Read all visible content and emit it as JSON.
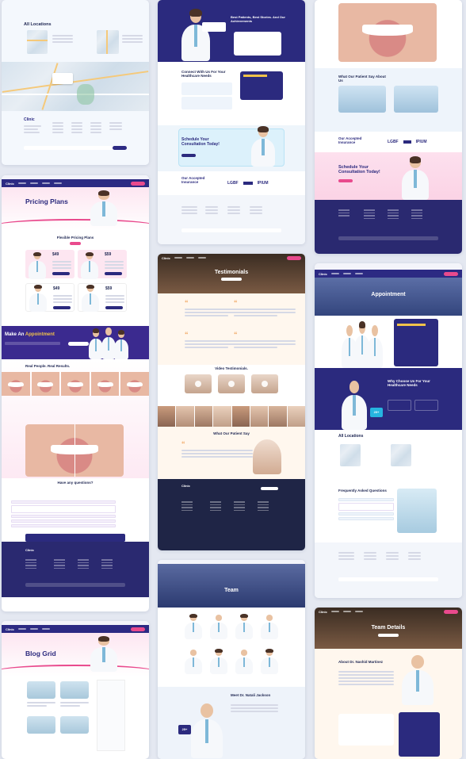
{
  "brand": {
    "name": "Clinic",
    "accent": "#e94a8d",
    "primary": "#2c2a83",
    "navy": "#232b55"
  },
  "col1": {
    "locations": {
      "title": "All Locations"
    },
    "pricing": {
      "hero_title": "Pricing Plans",
      "section_title": "Flexible Pricing Plans",
      "plans": [
        {
          "price": "$49"
        },
        {
          "price": "$59"
        },
        {
          "price": "$49"
        },
        {
          "price": "$59"
        }
      ]
    },
    "appointment_banner": {
      "prefix": "Make An ",
      "highlight": "Appointment"
    },
    "results": {
      "title": "Real People. Real Results."
    },
    "faq": {
      "title": "Have any questions?"
    },
    "blog": {
      "hero_title": "Blog Grid"
    }
  },
  "col2": {
    "achievements": {
      "title": "Best Patients, Best Stories. And Our Achievements"
    },
    "connect": {
      "title": "Connect With Us For Your Healthcare Needs"
    },
    "schedule": {
      "title": "Schedule Your Consultation Today!"
    },
    "insurance": {
      "title": "Our Accepted Insurance",
      "logos": [
        "LGBF",
        "IPIUM"
      ]
    },
    "testimonials": {
      "hero_title": "Testimonials",
      "video_title": "Video Testimonials.",
      "patient_title": "What Our Patient Say"
    },
    "team": {
      "hero_title": "Team",
      "featured": "Meet Dr. Natali Jackson",
      "badge": "25+"
    }
  },
  "col3": {
    "patient_say": {
      "title": "What Our Patient Say About Us"
    },
    "insurance": {
      "title": "Our Accepted Insurance",
      "logos": [
        "LGBF",
        "IPIUM"
      ]
    },
    "schedule": {
      "title": "Schedule Your Consultation Today!"
    },
    "appointment": {
      "hero_title": "Appointment",
      "why_title": "Why Choose Us For Your Healthcare Needs",
      "badge": "20+"
    },
    "locations": {
      "title": "All Locations"
    },
    "faq": {
      "title": "Frequently Asked Questions"
    },
    "team_details": {
      "hero_title": "Team Details",
      "name": "About Dr. Nashid Martinez"
    }
  }
}
